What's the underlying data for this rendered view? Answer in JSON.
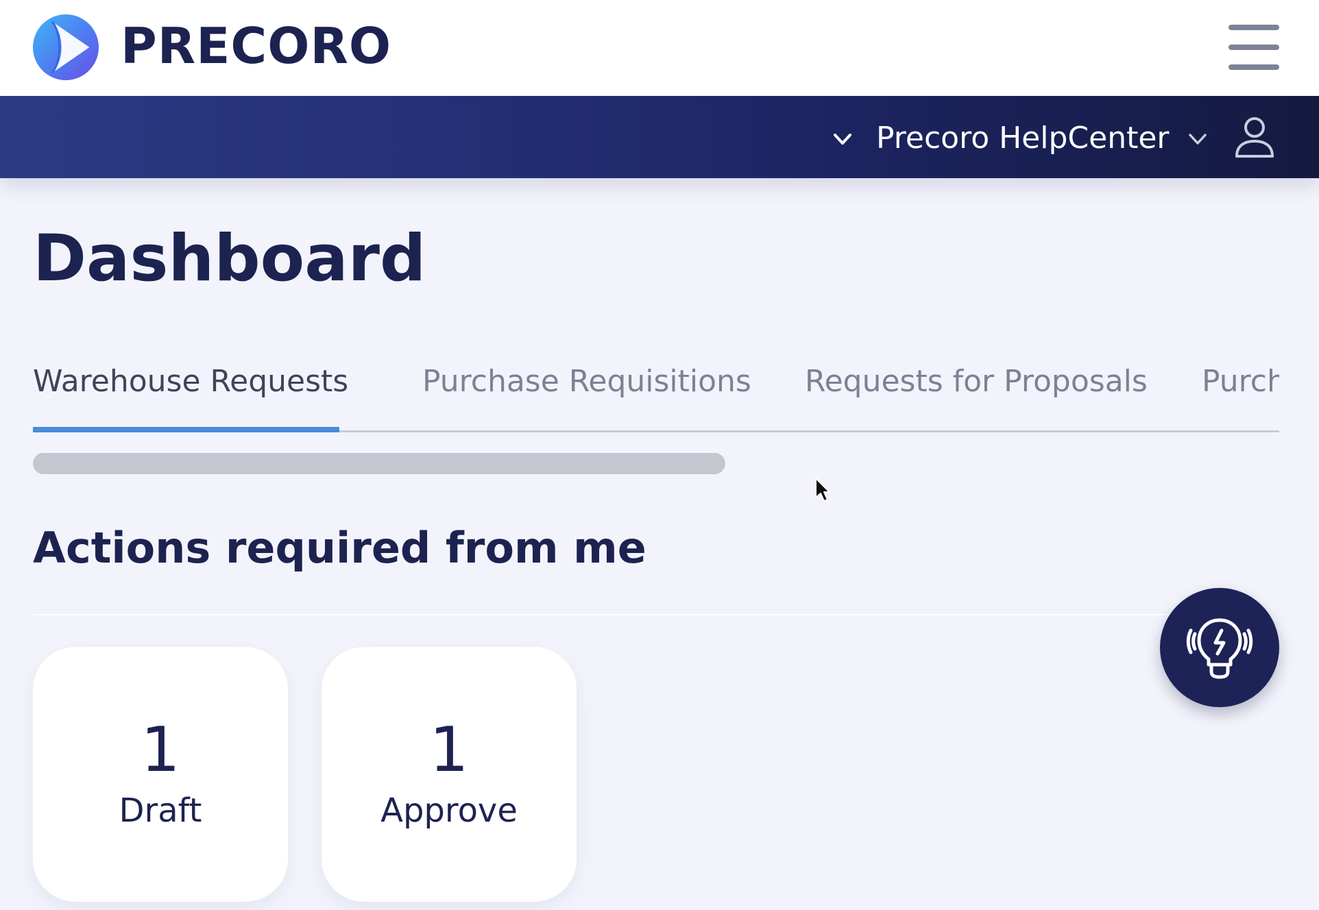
{
  "header": {
    "brand_name": "PRECORO",
    "logo_icon": "precoro-logo-icon",
    "menu_icon": "hamburger-menu-icon"
  },
  "navbar": {
    "workspace_name": "Precoro HelpCenter",
    "icons": [
      "chevron-down-icon",
      "chevron-down-icon",
      "user-icon"
    ]
  },
  "page": {
    "title": "Dashboard"
  },
  "tabs": [
    {
      "label": "Warehouse Requests",
      "active": true
    },
    {
      "label": "Purchase Requisitions",
      "active": false
    },
    {
      "label": "Requests for Proposals",
      "active": false
    },
    {
      "label": "Purch",
      "active": false
    }
  ],
  "actions": {
    "title": "Actions required from me",
    "cards": [
      {
        "count": "1",
        "label": "Draft"
      },
      {
        "count": "1",
        "label": "Approve"
      }
    ]
  },
  "help_button": {
    "icon": "lightbulb-icon"
  },
  "colors": {
    "primary_dark": "#1d2350",
    "tab_accent": "#4a8bdc",
    "page_background": "#f3f4fb"
  }
}
